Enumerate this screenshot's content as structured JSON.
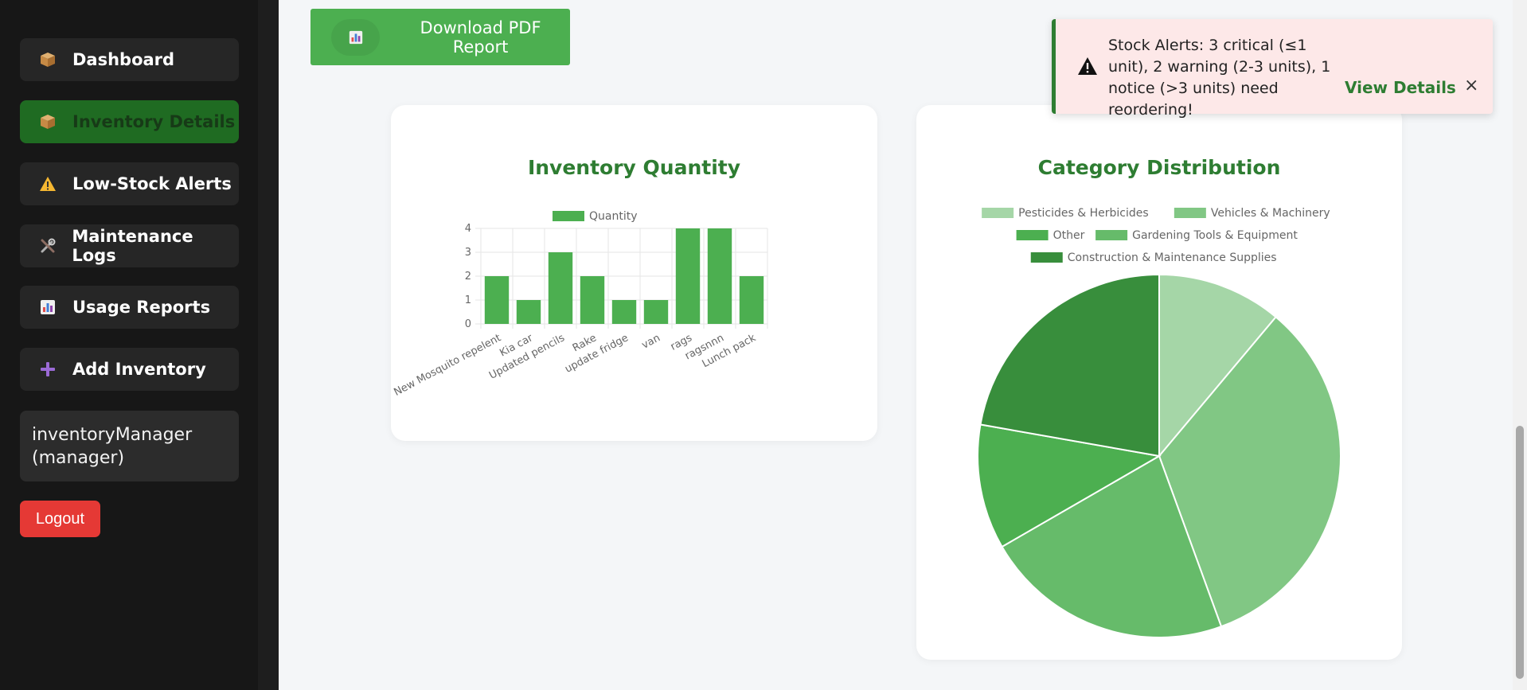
{
  "sidebar": {
    "items": [
      {
        "label": "Dashboard",
        "icon": "package-icon",
        "active": false
      },
      {
        "label": "Inventory Details",
        "icon": "package-icon",
        "active": true
      },
      {
        "label": "Low-Stock Alerts",
        "icon": "warning-icon",
        "active": false
      },
      {
        "label": "Maintenance Logs",
        "icon": "tools-icon",
        "active": false
      },
      {
        "label": "Usage Reports",
        "icon": "bar-chart-icon",
        "active": false
      },
      {
        "label": "Add Inventory",
        "icon": "plus-icon",
        "active": false
      }
    ],
    "user": {
      "name": "inventoryManager",
      "role": "(manager)"
    },
    "logout_label": "Logout"
  },
  "main": {
    "pdf_button": {
      "label": "Download PDF Report",
      "icon": "bar-chart-icon"
    }
  },
  "toast": {
    "message": "Stock Alerts: 3 critical (≤1 unit), 2 warning (2-3 units), 1 notice (>3 units) need reordering!",
    "details_label": "View Details",
    "close_label": "×",
    "accent": "#2e7d32",
    "background": "#fde8e8"
  },
  "colors": {
    "brand_green": "#4caf50",
    "title_green": "#2e7d32",
    "active_nav": "#1f6b22",
    "logout_red": "#e53935"
  },
  "chart_data": [
    {
      "type": "bar",
      "title": "Inventory Quantity",
      "categories": [
        "New Mosquito repelent",
        "Kia car",
        "Updated pencils",
        "Rake",
        "update fridge",
        "van",
        "rags",
        "ragsnnn",
        "Lunch pack"
      ],
      "series": [
        {
          "name": "Quantity",
          "values": [
            2,
            1,
            3,
            2,
            1,
            1,
            4,
            4,
            2
          ],
          "color": "#4caf50"
        }
      ],
      "yticks": [
        0,
        1,
        2,
        3,
        4
      ],
      "ylim": [
        0,
        4
      ],
      "grid": true,
      "legend": "top"
    },
    {
      "type": "pie",
      "title": "Category Distribution",
      "labels": [
        "Pesticides & Herbicides",
        "Vehicles & Machinery",
        "Gardening Tools & Equipment",
        "Other",
        "Construction & Maintenance Supplies"
      ],
      "values": [
        1,
        3,
        2,
        1,
        2
      ],
      "colors": [
        "#a5d6a7",
        "#81c784",
        "#66bb6a",
        "#4caf50",
        "#388e3c"
      ],
      "legend_rows": [
        [
          "Pesticides & Herbicides",
          "Vehicles & Machinery"
        ],
        [
          "Other",
          "Gardening Tools & Equipment"
        ],
        [
          "Construction & Maintenance Supplies"
        ]
      ],
      "legend": "top"
    }
  ]
}
